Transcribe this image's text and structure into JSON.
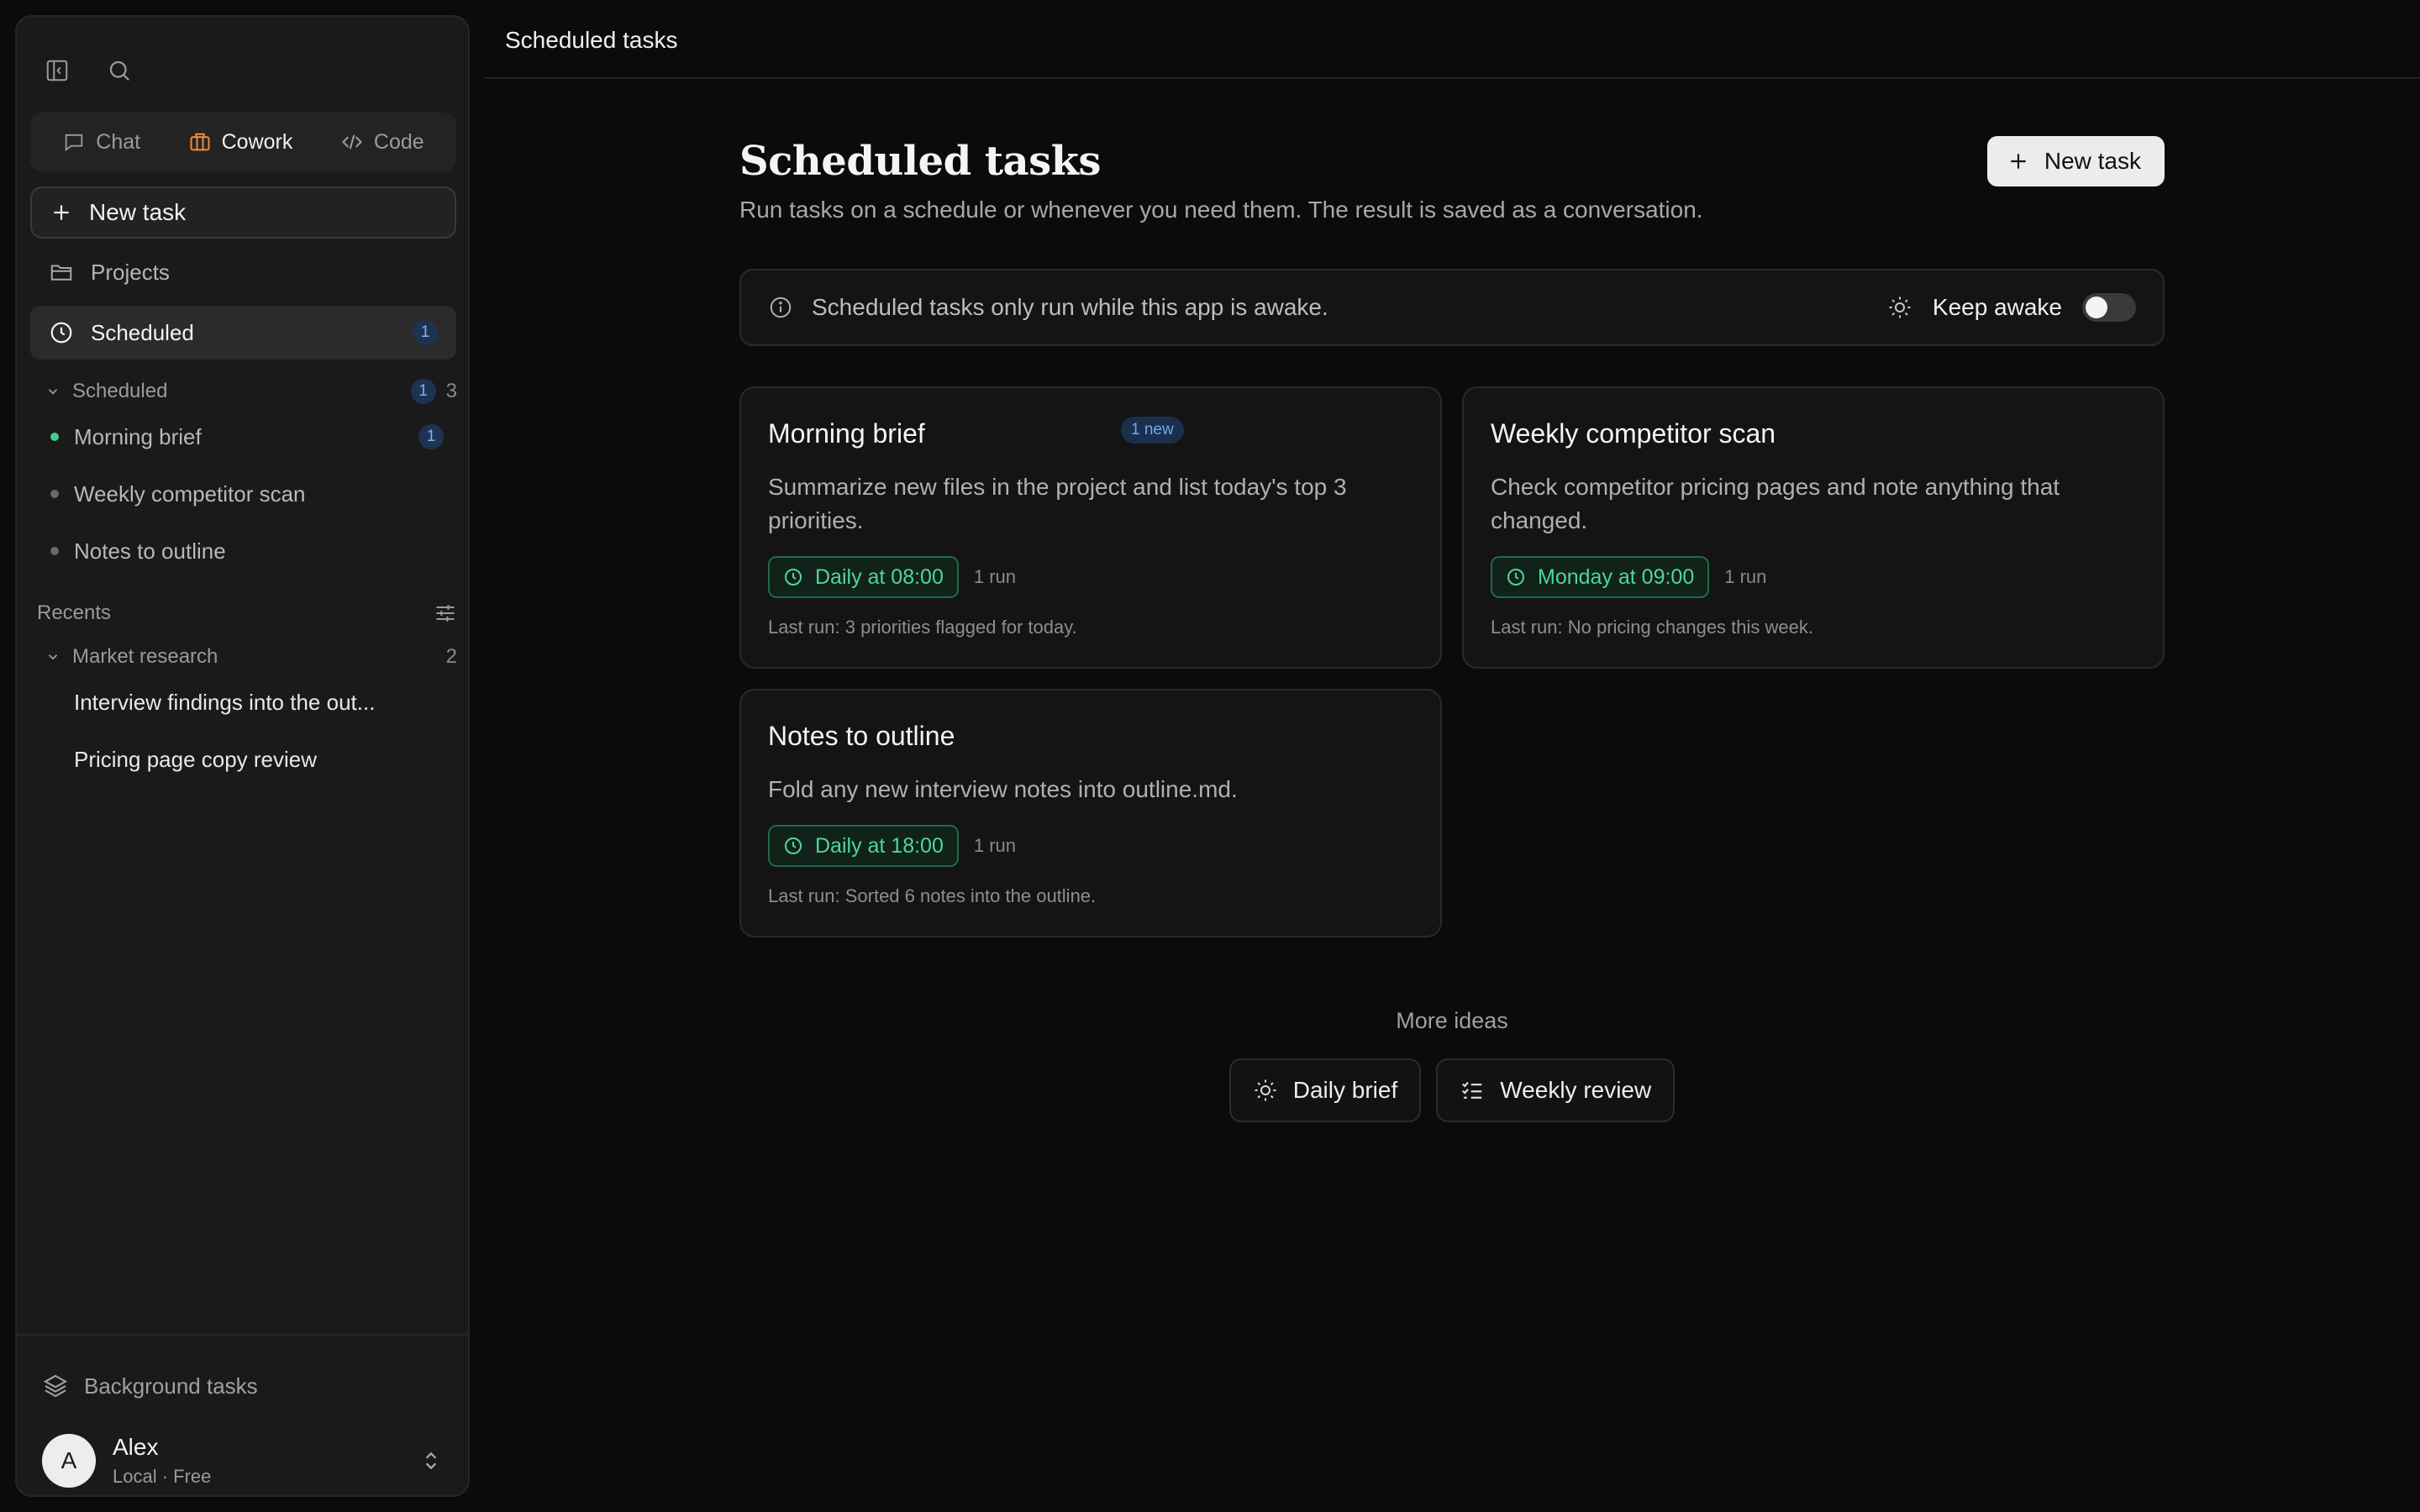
{
  "sidebar": {
    "modes": [
      {
        "label": "Chat",
        "icon": "chat-bubble-icon"
      },
      {
        "label": "Cowork",
        "icon": "briefcase-icon"
      },
      {
        "label": "Code",
        "icon": "code-icon"
      }
    ],
    "new_task": "New task",
    "projects": "Projects",
    "scheduled": {
      "label": "Scheduled",
      "badge": "1"
    },
    "scheduled_group": {
      "label": "Scheduled",
      "badge": "1",
      "count": "3"
    },
    "scheduled_items": [
      {
        "label": "Morning brief",
        "badge": "1"
      },
      {
        "label": "Weekly competitor scan"
      },
      {
        "label": "Notes to outline"
      }
    ],
    "recents_label": "Recents",
    "recents_group": {
      "label": "Market research",
      "count": "2"
    },
    "recent_items": [
      {
        "label": "Interview findings into the out..."
      },
      {
        "label": "Pricing page copy review"
      }
    ],
    "background_tasks": "Background tasks",
    "user": {
      "initial": "A",
      "name": "Alex",
      "plan": "Local · Free"
    }
  },
  "topbar": {
    "title": "Scheduled tasks"
  },
  "main": {
    "title": "Scheduled tasks",
    "subtitle": "Run tasks on a schedule or whenever you need them. The result is saved as a conversation.",
    "new_task": "New task",
    "notice": "Scheduled tasks only run while this app is awake.",
    "keep_awake": "Keep awake",
    "keep_awake_on": false
  },
  "tasks": [
    {
      "title": "Morning brief",
      "badge": "1 new",
      "description": "Summarize new files in the project and list today's top 3 priorities.",
      "schedule": "Daily at 08:00",
      "runs": "1 run",
      "last_run": "Last run: 3 priorities flagged for today."
    },
    {
      "title": "Weekly competitor scan",
      "description": "Check competitor pricing pages and note anything that changed.",
      "schedule": "Monday at 09:00",
      "runs": "1 run",
      "last_run": "Last run: No pricing changes this week."
    },
    {
      "title": "Notes to outline",
      "description": "Fold any new interview notes into outline.md.",
      "schedule": "Daily at 18:00",
      "runs": "1 run",
      "last_run": "Last run: Sorted 6 notes into the outline."
    }
  ],
  "ideas": {
    "title": "More ideas",
    "items": [
      {
        "label": "Daily brief",
        "icon": "sun-icon"
      },
      {
        "label": "Weekly review",
        "icon": "checklist-icon"
      }
    ]
  },
  "colors": {
    "accent_green": "#4fd69b",
    "badge_blue": "#7fb2f5",
    "cowork_orange": "#e8893c"
  }
}
